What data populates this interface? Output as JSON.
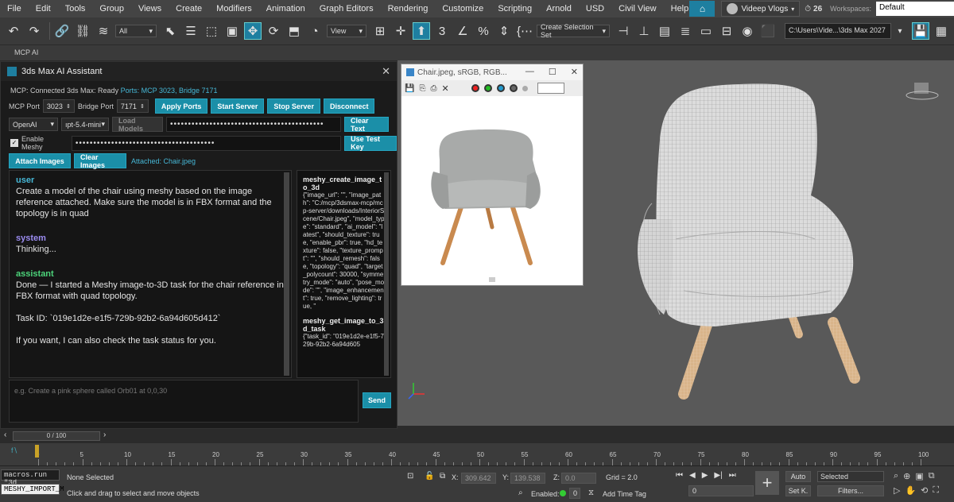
{
  "menu": [
    "File",
    "Edit",
    "Tools",
    "Group",
    "Views",
    "Create",
    "Modifiers",
    "Animation",
    "Graph Editors",
    "Rendering",
    "Customize",
    "Scripting",
    "Arnold",
    "USD",
    "Civil View",
    "Help"
  ],
  "account": {
    "user": "Videep Vlogs",
    "notifications": "26"
  },
  "workspace": {
    "label": "Workspaces:",
    "value": "Default"
  },
  "toolbar": {
    "filter": "All",
    "view": "View",
    "selection_set": "Create Selection Set",
    "project_path": "C:\\Users\\Vide...\\3ds Max 2027"
  },
  "mcp_label": "MCP AI",
  "panel": {
    "title": "3ds Max AI Assistant",
    "status_prefix": "MCP: Connected 3ds Max: Ready",
    "status_ports": "Ports: MCP 3023, Bridge 7171",
    "mcp_port_label": "MCP Port",
    "mcp_port": "3023",
    "bridge_port_label": "Bridge Port",
    "bridge_port": "7171",
    "apply_ports": "Apply Ports",
    "start_server": "Start Server",
    "stop_server": "Stop Server",
    "disconnect": "Disconnect",
    "provider": "OpenAI",
    "model": "ıpt-5.4-mini",
    "load_models": "Load Models",
    "api_key_mask": "•••••••••••••••••••••••••••••••••••••••••••",
    "clear_text": "Clear Text",
    "enable_meshy": "Enable Meshy",
    "meshy_key_mask": "•••••••••••••••••••••••••••••••••••••••",
    "use_test_key": "Use Test Key",
    "attach_images": "Attach Images",
    "clear_images": "Clear Images",
    "attached": "Attached: Chair.jpeg",
    "prompt_placeholder": "e.g. Create a pink sphere called Orb01 at 0,0,30",
    "send": "Send"
  },
  "chat": [
    {
      "role": "user",
      "color": "#46b7d6",
      "text": "Create a model of the chair using meshy based on the image reference attached. Make sure the model is in FBX format and the topology is in quad"
    },
    {
      "role": "system",
      "color": "#9b8cf0",
      "text": "Thinking..."
    },
    {
      "role": "assistant",
      "color": "#4cd37a",
      "text": "Done — I started a Meshy image-to-3D task for the chair reference in FBX format with quad topology."
    },
    {
      "role": "",
      "color": "#e4e4e4",
      "text": "Task ID: `019e1d2e-e1f5-729b-92b2-6a94d605d412`"
    },
    {
      "role": "",
      "color": "#e4e4e4",
      "text": "If you want, I can also check the task status for you."
    }
  ],
  "tool_calls": [
    {
      "name": "meshy_create_image_to_3d",
      "args": "{\"image_url\": \"\", \"image_path\": \"C:/mcp/3dsmax-mcp/mcp-server/downloads/InteriorScene/Chair.jpeg\", \"model_type\": \"standard\", \"ai_model\": \"latest\", \"should_texture\": true, \"enable_pbr\": true, \"hd_texture\": false, \"texture_prompt\": \"\", \"should_remesh\": false, \"topology\": \"quad\", \"target_polycount\": 30000, \"symmetry_mode\": \"auto\", \"pose_mode\": \"\", \"image_enhancement\": true, \"remove_lighting\": true, \""
    },
    {
      "name": "meshy_get_image_to_3d_task",
      "args": "{\"task_id\": \"019e1d2e-e1f5-729b-92b2-6a94d605"
    }
  ],
  "image_window": {
    "title": "Chair.jpeg, sRGB, RGB..."
  },
  "timeline": {
    "frame": "0 / 100",
    "ticks": [
      0,
      5,
      10,
      15,
      20,
      25,
      30,
      35,
      40,
      45,
      50,
      55,
      60,
      65,
      70,
      75,
      80,
      85,
      90,
      95,
      100
    ]
  },
  "statusbar": {
    "script1": "macros.run \"3d",
    "script2": "MESHY_IMPORT_M",
    "selection": "None Selected",
    "hint": "Click and drag to select and move objects",
    "x_label": "X:",
    "x_val": "309.642",
    "y_label": "Y:",
    "y_val": "139.538",
    "z_label": "Z:",
    "z_val": "0.0",
    "grid": "Grid = 2.0",
    "enabled_label": "Enabled:",
    "enabled_val": "0",
    "add_time_tag": "Add Time Tag",
    "auto": "Auto",
    "selected": "Selected",
    "set_key": "Set K.",
    "filters": "Filters...",
    "frame_field": "0"
  }
}
